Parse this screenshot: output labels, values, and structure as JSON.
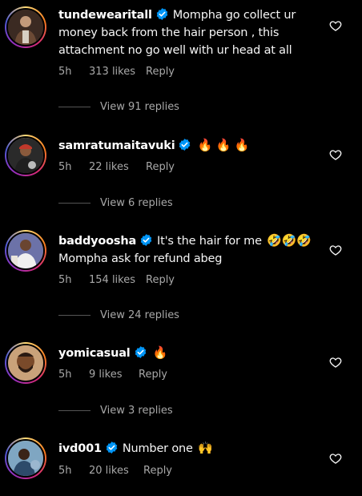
{
  "comments": [
    {
      "username": "tundewearitall",
      "text": "Mompha go collect ur money back from the hair person , this attachment no go well with ur head at all",
      "emoji": "",
      "time": "5h",
      "likes": "313 likes",
      "reply_label": "Reply",
      "view_replies": "View 91 replies",
      "avatar_color": "#6b4a35"
    },
    {
      "username": "samratumaitavuki",
      "text": "",
      "emoji": "🔥 🔥 🔥",
      "time": "5h",
      "likes": "22 likes",
      "reply_label": "Reply",
      "view_replies": "View 6 replies",
      "avatar_color": "#7a2f2a"
    },
    {
      "username": "baddyoosha",
      "text": "It's the hair for me",
      "emoji": "🤣🤣🤣",
      "text2": "Mompha ask for refund abeg",
      "time": "5h",
      "likes": "154 likes",
      "reply_label": "Reply",
      "view_replies": "View 24 replies",
      "avatar_color": "#5a5f8f"
    },
    {
      "username": "yomicasual",
      "text": "",
      "emoji": "🔥",
      "time": "5h",
      "likes": "9 likes",
      "reply_label": "Reply",
      "view_replies": "View 3 replies",
      "avatar_color": "#8a5a32"
    },
    {
      "username": "ivd001",
      "text": "Number one",
      "emoji": "🙌",
      "time": "5h",
      "likes": "20 likes",
      "reply_label": "Reply",
      "avatar_color": "#4f7a9a"
    }
  ],
  "colors": {
    "background": "#000000",
    "text": "#f5f5f5",
    "secondary": "#a8a8a8",
    "verified_badge": "#0095f6"
  },
  "icons": {
    "verified": "verified-badge-icon",
    "like": "heart-outline-icon"
  }
}
